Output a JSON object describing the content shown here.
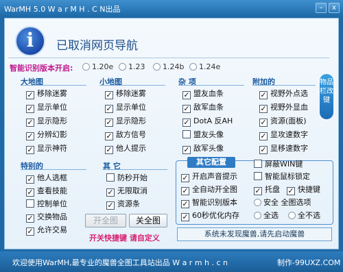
{
  "window": {
    "title": "WarMH 5.0 W a r M H . C N出品",
    "min_icon": "–",
    "close_icon": "x"
  },
  "header": {
    "message": "已取消网页导航"
  },
  "version": {
    "label": "智能识别版本开启:",
    "options": [
      "1.20e",
      "1.23",
      "1.24b",
      "1.24e"
    ]
  },
  "sections": {
    "big_map": {
      "title": "大地图",
      "items": [
        "移除迷雾",
        "显示单位",
        "显示隐形",
        "分辨幻影",
        "显示神符"
      ]
    },
    "small_map": {
      "title": "小地图",
      "items": [
        "移除迷雾",
        "显示单位",
        "显示隐形",
        "敌方信号",
        "他人提示"
      ]
    },
    "misc": {
      "title": "杂 项",
      "items": [
        "盟友血条",
        "敌军血条",
        "DotA 反AH",
        "盟友头像",
        "敌军头像"
      ]
    },
    "addon": {
      "title": "附加的",
      "items": [
        "视野外点选",
        "视野外显血",
        "资源(面板)",
        "显攻速数字",
        "显移速数字"
      ]
    },
    "special": {
      "title": "特别的",
      "items": [
        "他人选框",
        "查看技能",
        "控制单位",
        "交换物品",
        "允许交易"
      ]
    },
    "other": {
      "title": "其 它",
      "items": [
        "防秒开始",
        "无限取消",
        "资源条"
      ]
    }
  },
  "side_tab": {
    "label": "物品栏改键"
  },
  "config": {
    "title": "其它配置",
    "col_left": [
      "开启声音提示",
      "全自动开全图",
      "智能识别版本",
      "60秒优化内存"
    ],
    "shield_win": "屏蔽WIN键",
    "smart_mouse": "智能鼠标锁定",
    "hosting": "托盘",
    "hotkey": "快捷键",
    "safe_full": "安全 全图选项",
    "select_all": "全选",
    "select_none": "全不选",
    "check_mark": "✓"
  },
  "buttons": {
    "open_map": "开全图",
    "close_map": "关全图"
  },
  "hint": "开关快捷键 请自定义",
  "status_message": "系统未发现魔兽,请先启动魔兽",
  "statusbar": {
    "left": "欢迎使用WarMH,最专业的魔兽全图工具站出品 W a r m h . c n",
    "right": "制作-99UXZ.COM"
  }
}
